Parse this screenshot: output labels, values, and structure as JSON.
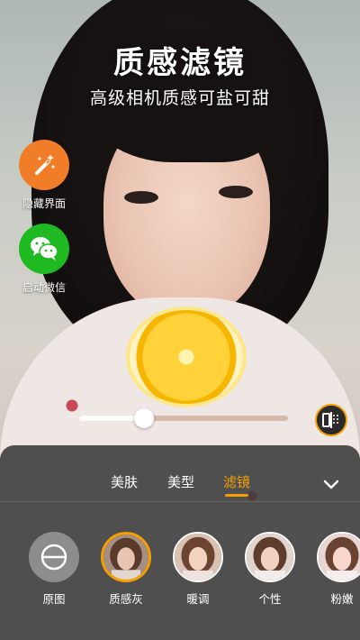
{
  "header": {
    "title": "质感滤镜",
    "subtitle": "高级相机质感可盐可甜"
  },
  "side_buttons": [
    {
      "label": "隐藏界面",
      "icon": "magic-wand-icon",
      "color": "#f27d28"
    },
    {
      "label": "启动微信",
      "icon": "wechat-icon",
      "color": "#1fb922"
    }
  ],
  "slider": {
    "value_percent": 31
  },
  "tabs": [
    {
      "label": "美肤",
      "active": false
    },
    {
      "label": "美型",
      "active": false
    },
    {
      "label": "滤镜",
      "active": true
    }
  ],
  "filters": [
    {
      "label": "原图",
      "icon": "no-filter-icon",
      "selected": false
    },
    {
      "label": "质感灰",
      "selected": true
    },
    {
      "label": "暖调",
      "selected": false
    },
    {
      "label": "个性",
      "selected": false
    },
    {
      "label": "粉嫩",
      "selected": false
    }
  ],
  "colors": {
    "accent": "#f5a000",
    "panel": "#3a3a3a"
  }
}
